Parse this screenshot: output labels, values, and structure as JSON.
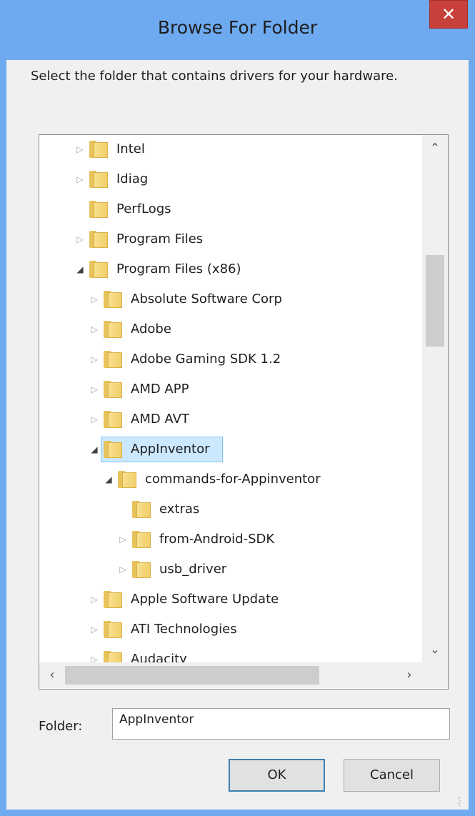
{
  "window": {
    "title": "Browse For Folder",
    "close_icon": "close-icon"
  },
  "description": "Select the folder that contains drivers for your hardware.",
  "tree": {
    "items": [
      {
        "label": "Intel",
        "level": 1,
        "state": "collapsed"
      },
      {
        "label": "Idiag",
        "level": 1,
        "state": "collapsed"
      },
      {
        "label": "PerfLogs",
        "level": 1,
        "state": "leaf"
      },
      {
        "label": "Program Files",
        "level": 1,
        "state": "collapsed"
      },
      {
        "label": "Program Files (x86)",
        "level": 1,
        "state": "expanded"
      },
      {
        "label": "Absolute Software Corp",
        "level": 2,
        "state": "collapsed"
      },
      {
        "label": "Adobe",
        "level": 2,
        "state": "collapsed"
      },
      {
        "label": "Adobe Gaming SDK 1.2",
        "level": 2,
        "state": "collapsed"
      },
      {
        "label": "AMD APP",
        "level": 2,
        "state": "collapsed"
      },
      {
        "label": "AMD AVT",
        "level": 2,
        "state": "collapsed"
      },
      {
        "label": "AppInventor",
        "level": 2,
        "state": "expanded",
        "selected": true
      },
      {
        "label": "commands-for-Appinventor",
        "level": 3,
        "state": "expanded"
      },
      {
        "label": "extras",
        "level": 4,
        "state": "leaf"
      },
      {
        "label": "from-Android-SDK",
        "level": 4,
        "state": "collapsed"
      },
      {
        "label": "usb_driver",
        "level": 4,
        "state": "collapsed"
      },
      {
        "label": "Apple Software Update",
        "level": 2,
        "state": "collapsed"
      },
      {
        "label": "ATI Technologies",
        "level": 2,
        "state": "collapsed"
      },
      {
        "label": "Audacity",
        "level": 2,
        "state": "collapsed"
      }
    ]
  },
  "folder_field": {
    "label": "Folder:",
    "value": "AppInventor"
  },
  "buttons": {
    "ok": "OK",
    "cancel": "Cancel"
  },
  "colors": {
    "titlebar": "#6eaaf0",
    "close": "#c7413a",
    "selection": "#cce8ff"
  }
}
